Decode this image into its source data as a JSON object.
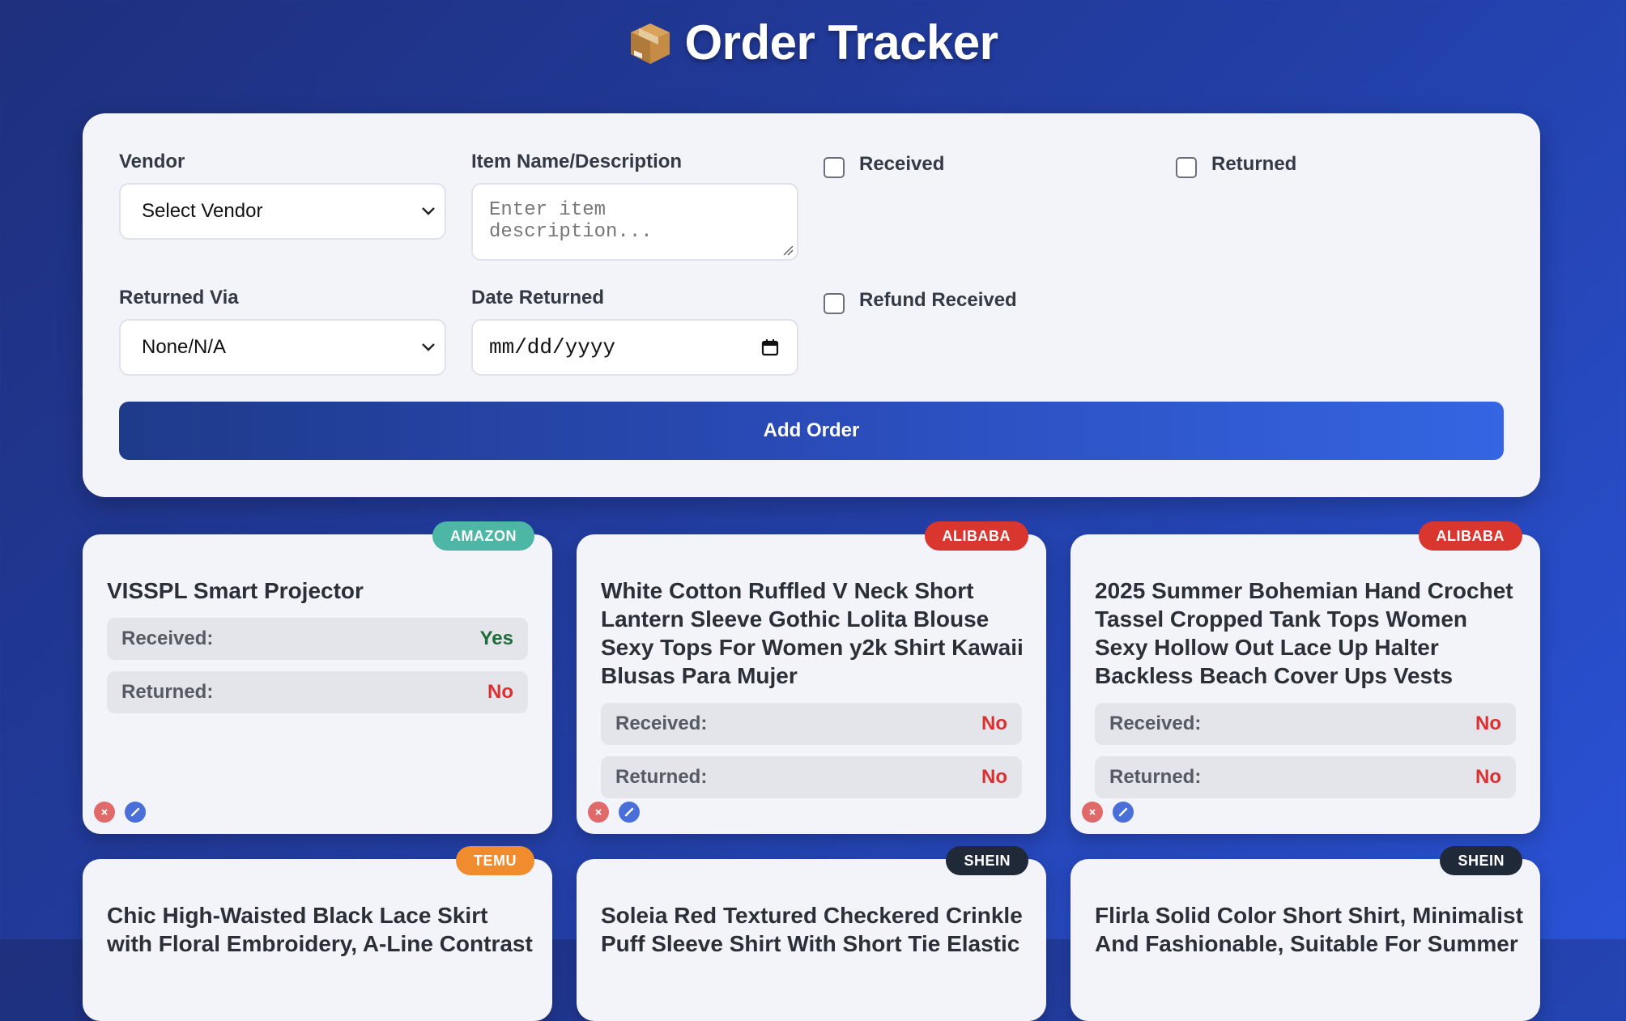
{
  "app": {
    "title": "Order Tracker",
    "icon": "package-icon"
  },
  "form": {
    "vendor": {
      "label": "Vendor",
      "selected": "Select Vendor"
    },
    "item": {
      "label": "Item Name/Description",
      "placeholder": "Enter item description..."
    },
    "received": {
      "label": "Received",
      "checked": false
    },
    "returned": {
      "label": "Returned",
      "checked": false
    },
    "returned_via": {
      "label": "Returned Via",
      "selected": "None/N/A"
    },
    "date_returned": {
      "label": "Date Returned",
      "placeholder": "mm/dd/yyyy"
    },
    "refund_received": {
      "label": "Refund Received",
      "checked": false
    },
    "add_button": "Add Order"
  },
  "colors": {
    "amazon": "#4db6a4",
    "alibaba": "#d9362f",
    "temu": "#f08c2e",
    "shein": "#1f2937",
    "delete": "#e06a6a",
    "edit": "#4a6fd8"
  },
  "orders": [
    {
      "vendor": "AMAZON",
      "title": "VISSPL Smart Projector",
      "received_label": "Received:",
      "received": "Yes",
      "returned_label": "Returned:",
      "returned": "No"
    },
    {
      "vendor": "ALIBABA",
      "title": "White Cotton Ruffled V Neck Short Lantern Sleeve Gothic Lolita Blouse Sexy Tops For Women y2k Shirt Kawaii Blusas Para Mujer",
      "received_label": "Received:",
      "received": "No",
      "returned_label": "Returned:",
      "returned": "No"
    },
    {
      "vendor": "ALIBABA",
      "title": "2025 Summer Bohemian Hand Crochet Tassel Cropped Tank Tops Women Sexy Hollow Out Lace Up Halter Backless Beach Cover Ups Vests",
      "received_label": "Received:",
      "received": "No",
      "returned_label": "Returned:",
      "returned": "No"
    },
    {
      "vendor": "TEMU",
      "title": "Chic High-Waisted Black Lace Skirt with Floral Embroidery, A-Line Contrast"
    },
    {
      "vendor": "SHEIN",
      "title": "Soleia Red Textured Checkered Crinkle Puff Sleeve Shirt With Short Tie Elastic"
    },
    {
      "vendor": "SHEIN",
      "title": "Flirla Solid Color Short Shirt, Minimalist And Fashionable, Suitable For Summer"
    }
  ]
}
